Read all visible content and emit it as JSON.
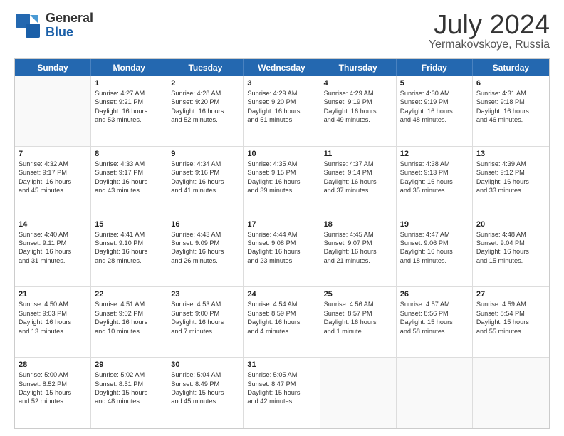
{
  "logo": {
    "line1": "General",
    "line2": "Blue"
  },
  "title": "July 2024",
  "location": "Yermakovskoye, Russia",
  "header_days": [
    "Sunday",
    "Monday",
    "Tuesday",
    "Wednesday",
    "Thursday",
    "Friday",
    "Saturday"
  ],
  "weeks": [
    [
      {
        "day": "",
        "sunrise": "",
        "sunset": "",
        "daylight": ""
      },
      {
        "day": "1",
        "sunrise": "Sunrise: 4:27 AM",
        "sunset": "Sunset: 9:21 PM",
        "daylight": "Daylight: 16 hours",
        "daylight2": "and 53 minutes."
      },
      {
        "day": "2",
        "sunrise": "Sunrise: 4:28 AM",
        "sunset": "Sunset: 9:20 PM",
        "daylight": "Daylight: 16 hours",
        "daylight2": "and 52 minutes."
      },
      {
        "day": "3",
        "sunrise": "Sunrise: 4:29 AM",
        "sunset": "Sunset: 9:20 PM",
        "daylight": "Daylight: 16 hours",
        "daylight2": "and 51 minutes."
      },
      {
        "day": "4",
        "sunrise": "Sunrise: 4:29 AM",
        "sunset": "Sunset: 9:19 PM",
        "daylight": "Daylight: 16 hours",
        "daylight2": "and 49 minutes."
      },
      {
        "day": "5",
        "sunrise": "Sunrise: 4:30 AM",
        "sunset": "Sunset: 9:19 PM",
        "daylight": "Daylight: 16 hours",
        "daylight2": "and 48 minutes."
      },
      {
        "day": "6",
        "sunrise": "Sunrise: 4:31 AM",
        "sunset": "Sunset: 9:18 PM",
        "daylight": "Daylight: 16 hours",
        "daylight2": "and 46 minutes."
      }
    ],
    [
      {
        "day": "7",
        "sunrise": "Sunrise: 4:32 AM",
        "sunset": "Sunset: 9:17 PM",
        "daylight": "Daylight: 16 hours",
        "daylight2": "and 45 minutes."
      },
      {
        "day": "8",
        "sunrise": "Sunrise: 4:33 AM",
        "sunset": "Sunset: 9:17 PM",
        "daylight": "Daylight: 16 hours",
        "daylight2": "and 43 minutes."
      },
      {
        "day": "9",
        "sunrise": "Sunrise: 4:34 AM",
        "sunset": "Sunset: 9:16 PM",
        "daylight": "Daylight: 16 hours",
        "daylight2": "and 41 minutes."
      },
      {
        "day": "10",
        "sunrise": "Sunrise: 4:35 AM",
        "sunset": "Sunset: 9:15 PM",
        "daylight": "Daylight: 16 hours",
        "daylight2": "and 39 minutes."
      },
      {
        "day": "11",
        "sunrise": "Sunrise: 4:37 AM",
        "sunset": "Sunset: 9:14 PM",
        "daylight": "Daylight: 16 hours",
        "daylight2": "and 37 minutes."
      },
      {
        "day": "12",
        "sunrise": "Sunrise: 4:38 AM",
        "sunset": "Sunset: 9:13 PM",
        "daylight": "Daylight: 16 hours",
        "daylight2": "and 35 minutes."
      },
      {
        "day": "13",
        "sunrise": "Sunrise: 4:39 AM",
        "sunset": "Sunset: 9:12 PM",
        "daylight": "Daylight: 16 hours",
        "daylight2": "and 33 minutes."
      }
    ],
    [
      {
        "day": "14",
        "sunrise": "Sunrise: 4:40 AM",
        "sunset": "Sunset: 9:11 PM",
        "daylight": "Daylight: 16 hours",
        "daylight2": "and 31 minutes."
      },
      {
        "day": "15",
        "sunrise": "Sunrise: 4:41 AM",
        "sunset": "Sunset: 9:10 PM",
        "daylight": "Daylight: 16 hours",
        "daylight2": "and 28 minutes."
      },
      {
        "day": "16",
        "sunrise": "Sunrise: 4:43 AM",
        "sunset": "Sunset: 9:09 PM",
        "daylight": "Daylight: 16 hours",
        "daylight2": "and 26 minutes."
      },
      {
        "day": "17",
        "sunrise": "Sunrise: 4:44 AM",
        "sunset": "Sunset: 9:08 PM",
        "daylight": "Daylight: 16 hours",
        "daylight2": "and 23 minutes."
      },
      {
        "day": "18",
        "sunrise": "Sunrise: 4:45 AM",
        "sunset": "Sunset: 9:07 PM",
        "daylight": "Daylight: 16 hours",
        "daylight2": "and 21 minutes."
      },
      {
        "day": "19",
        "sunrise": "Sunrise: 4:47 AM",
        "sunset": "Sunset: 9:06 PM",
        "daylight": "Daylight: 16 hours",
        "daylight2": "and 18 minutes."
      },
      {
        "day": "20",
        "sunrise": "Sunrise: 4:48 AM",
        "sunset": "Sunset: 9:04 PM",
        "daylight": "Daylight: 16 hours",
        "daylight2": "and 15 minutes."
      }
    ],
    [
      {
        "day": "21",
        "sunrise": "Sunrise: 4:50 AM",
        "sunset": "Sunset: 9:03 PM",
        "daylight": "Daylight: 16 hours",
        "daylight2": "and 13 minutes."
      },
      {
        "day": "22",
        "sunrise": "Sunrise: 4:51 AM",
        "sunset": "Sunset: 9:02 PM",
        "daylight": "Daylight: 16 hours",
        "daylight2": "and 10 minutes."
      },
      {
        "day": "23",
        "sunrise": "Sunrise: 4:53 AM",
        "sunset": "Sunset: 9:00 PM",
        "daylight": "Daylight: 16 hours",
        "daylight2": "and 7 minutes."
      },
      {
        "day": "24",
        "sunrise": "Sunrise: 4:54 AM",
        "sunset": "Sunset: 8:59 PM",
        "daylight": "Daylight: 16 hours",
        "daylight2": "and 4 minutes."
      },
      {
        "day": "25",
        "sunrise": "Sunrise: 4:56 AM",
        "sunset": "Sunset: 8:57 PM",
        "daylight": "Daylight: 16 hours",
        "daylight2": "and 1 minute."
      },
      {
        "day": "26",
        "sunrise": "Sunrise: 4:57 AM",
        "sunset": "Sunset: 8:56 PM",
        "daylight": "Daylight: 15 hours",
        "daylight2": "and 58 minutes."
      },
      {
        "day": "27",
        "sunrise": "Sunrise: 4:59 AM",
        "sunset": "Sunset: 8:54 PM",
        "daylight": "Daylight: 15 hours",
        "daylight2": "and 55 minutes."
      }
    ],
    [
      {
        "day": "28",
        "sunrise": "Sunrise: 5:00 AM",
        "sunset": "Sunset: 8:52 PM",
        "daylight": "Daylight: 15 hours",
        "daylight2": "and 52 minutes."
      },
      {
        "day": "29",
        "sunrise": "Sunrise: 5:02 AM",
        "sunset": "Sunset: 8:51 PM",
        "daylight": "Daylight: 15 hours",
        "daylight2": "and 48 minutes."
      },
      {
        "day": "30",
        "sunrise": "Sunrise: 5:04 AM",
        "sunset": "Sunset: 8:49 PM",
        "daylight": "Daylight: 15 hours",
        "daylight2": "and 45 minutes."
      },
      {
        "day": "31",
        "sunrise": "Sunrise: 5:05 AM",
        "sunset": "Sunset: 8:47 PM",
        "daylight": "Daylight: 15 hours",
        "daylight2": "and 42 minutes."
      },
      {
        "day": "",
        "sunrise": "",
        "sunset": "",
        "daylight": "",
        "daylight2": ""
      },
      {
        "day": "",
        "sunrise": "",
        "sunset": "",
        "daylight": "",
        "daylight2": ""
      },
      {
        "day": "",
        "sunrise": "",
        "sunset": "",
        "daylight": "",
        "daylight2": ""
      }
    ]
  ]
}
